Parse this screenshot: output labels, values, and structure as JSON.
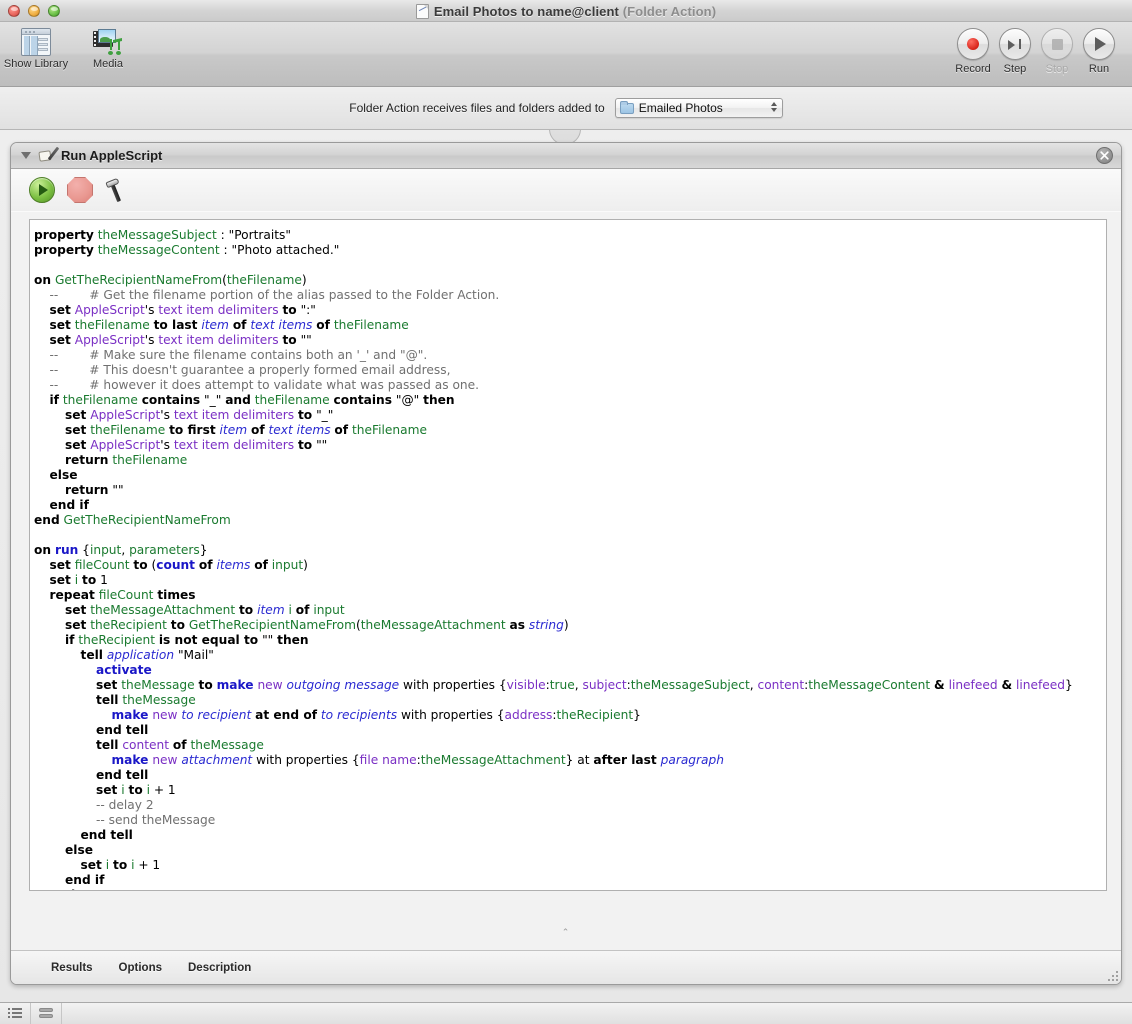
{
  "window": {
    "title": "Email Photos to name@client",
    "title_suffix": "(Folder Action)",
    "doc_icon": "applescript-document-icon",
    "traffic_lights": [
      "close",
      "minimize",
      "zoom"
    ]
  },
  "toolbar": {
    "left_items": [
      {
        "label": "Show Library",
        "icon": "library-icon"
      },
      {
        "label": "Media",
        "icon": "media-icon"
      }
    ],
    "right_items": [
      {
        "label": "Record",
        "icon": "record-icon",
        "enabled": true
      },
      {
        "label": "Step",
        "icon": "step-icon",
        "enabled": true
      },
      {
        "label": "Stop",
        "icon": "stop-icon",
        "enabled": false
      },
      {
        "label": "Run",
        "icon": "run-icon",
        "enabled": true
      }
    ]
  },
  "action_bar": {
    "label": "Folder Action receives files and folders added to",
    "popup_value": "Emailed Photos",
    "popup_icon": "folder-icon"
  },
  "action_card": {
    "title": "Run AppleScript",
    "icon": "applescript-icon",
    "close_label": "×",
    "script_toolbar": [
      {
        "name": "run-script-button",
        "icon": "green-play-icon"
      },
      {
        "name": "stop-script-button",
        "icon": "red-stop-octagon-icon"
      },
      {
        "name": "compile-script-button",
        "icon": "hammer-icon"
      }
    ],
    "footer_tabs": [
      "Results",
      "Options",
      "Description"
    ]
  },
  "script": {
    "language": "AppleScript",
    "text": "property theMessageSubject : \"Portraits\"\nproperty theMessageContent : \"Photo attached.\"\n\non GetTheRecipientNameFrom(theFilename)\n    --        # Get the filename portion of the alias passed to the Folder Action.\n    set AppleScript's text item delimiters to \":\"\n    set theFilename to last item of text items of theFilename\n    set AppleScript's text item delimiters to \"\"\n    --        # Make sure the filename contains both an '_' and \"@\".\n    --        # This doesn't guarantee a properly formed email address,\n    --        # however it does attempt to validate what was passed as one.\n    if theFilename contains \"_\" and theFilename contains \"@\" then\n        set AppleScript's text item delimiters to \"_\"\n        set theFilename to first item of text items of theFilename\n        set AppleScript's text item delimiters to \"\"\n        return theFilename\n    else\n        return \"\"\n    end if\nend GetTheRecipientNameFrom\n\non run {input, parameters}\n    set fileCount to (count of items of input)\n    set i to 1\n    repeat fileCount times\n        set theMessageAttachment to item i of input\n        set theRecipient to GetTheRecipientNameFrom(theMessageAttachment as string)\n        if theRecipient is not equal to \"\" then\n            tell application \"Mail\"\n                activate\n                set theMessage to make new outgoing message with properties {visible:true, subject:theMessageSubject, content:theMessageContent & linefeed & linefeed}\n                tell theMessage\n                    make new to recipient at end of to recipients with properties {address:theRecipient}\n                end tell\n                tell content of theMessage\n                    make new attachment with properties {file name:theMessageAttachment} at after last paragraph\n                end tell\n                set i to i + 1\n                -- delay 2\n                -- send theMessage\n            end tell\n        else\n            set i to i + 1\n        end if\n    end repeat\nend run"
  },
  "status_bar": {
    "buttons": [
      {
        "name": "log-list-button",
        "icon": "list-view-icon"
      },
      {
        "name": "log-rows-button",
        "icon": "row-view-icon"
      }
    ]
  },
  "colors": {
    "keyword": "#000000",
    "command": "#1a17c7",
    "variable": "#1a7a2f",
    "reference": "#7a2fc4",
    "class": "#2a2ad1",
    "comment": "#707070",
    "accent_green": "#7dc043",
    "accent_red": "#d7241a"
  }
}
